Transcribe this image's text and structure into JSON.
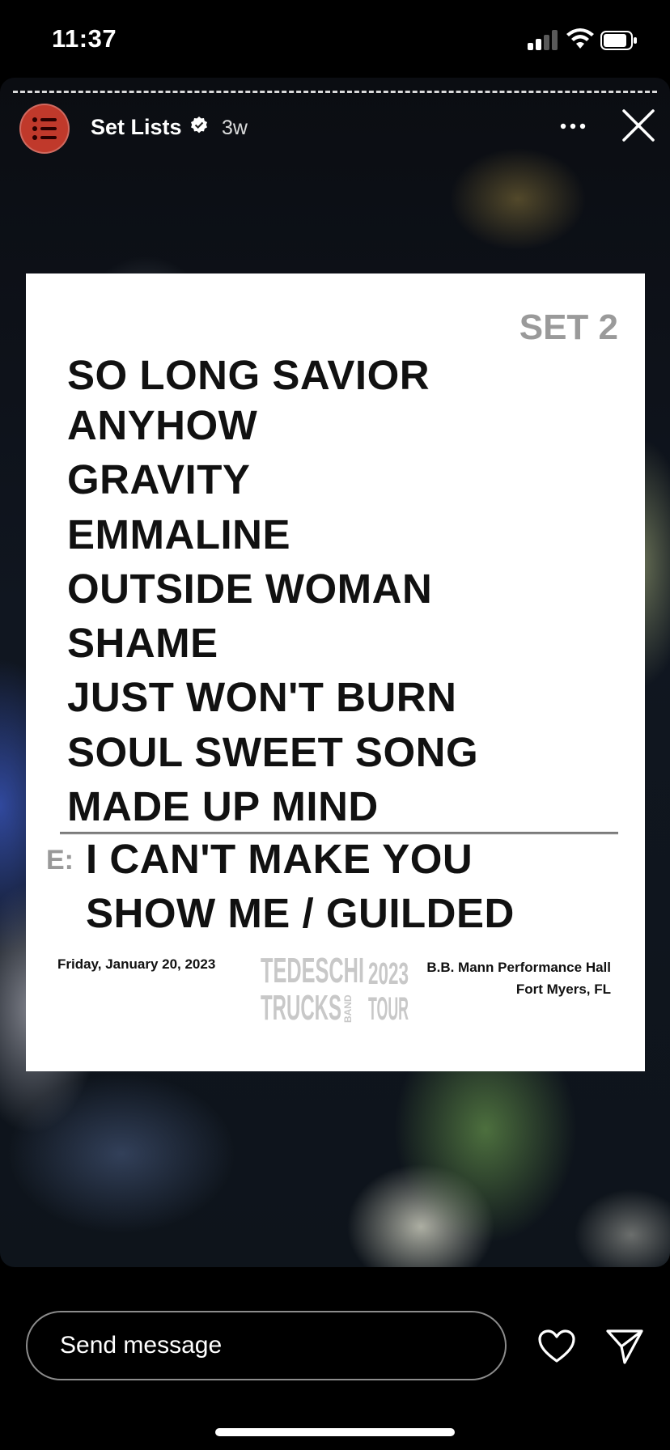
{
  "status_bar": {
    "time": "11:37",
    "signal_bars_filled": 2,
    "signal_bars_total": 4
  },
  "story": {
    "account_name": "Set Lists",
    "verified": true,
    "post_age": "3w",
    "progress_segments": 1
  },
  "setlist": {
    "set_label": "SET 2",
    "songs": [
      "SO LONG SAVIOR",
      "ANYHOW",
      "GRAVITY",
      "EMMALINE",
      "OUTSIDE WOMAN",
      "SHAME",
      "JUST WON'T BURN",
      "SOUL SWEET SONG",
      "MADE UP MIND"
    ],
    "encore_label": "E:",
    "encore_songs": [
      "I CAN'T MAKE YOU",
      "SHOW ME / GUILDED"
    ],
    "date": "Friday, January 20, 2023",
    "venue": "B.B. Mann Performance Hall",
    "city": "Fort Myers, FL",
    "logo": {
      "line1": "TEDESCHI",
      "line2": "TRUCKS",
      "band": "BAND",
      "year": "2023",
      "tour": "TOUR"
    }
  },
  "composer": {
    "placeholder": "Send message"
  },
  "colors": {
    "avatar": "#c0392b",
    "logo_gray": "#c8c8c8",
    "set_label": "#9a9a9a"
  }
}
